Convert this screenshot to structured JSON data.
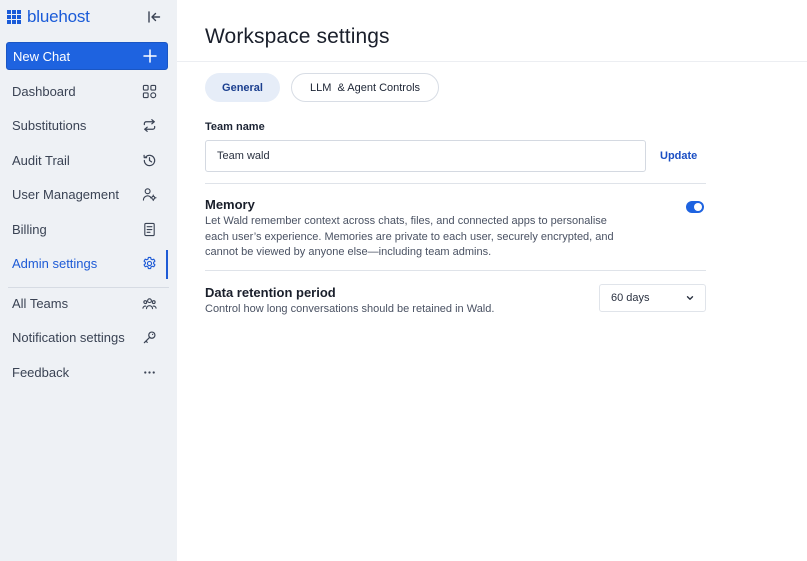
{
  "brand": {
    "name": "bluehost"
  },
  "sidebar": {
    "new_chat_label": "New Chat",
    "items": [
      {
        "label": "Dashboard",
        "icon": "dashboard-icon"
      },
      {
        "label": "Substitutions",
        "icon": "swap-icon"
      },
      {
        "label": "Audit Trail",
        "icon": "history-icon"
      },
      {
        "label": "User Management",
        "icon": "user-management-icon"
      },
      {
        "label": "Billing",
        "icon": "billing-icon"
      },
      {
        "label": "Admin settings",
        "icon": "gear-icon",
        "active": true
      }
    ],
    "secondary_items": [
      {
        "label": "All Teams",
        "icon": "teams-icon"
      },
      {
        "label": "Notification settings",
        "icon": "key-icon"
      },
      {
        "label": "Feedback",
        "icon": "more-icon"
      }
    ]
  },
  "main": {
    "title": "Workspace settings",
    "tabs": [
      {
        "label": "General",
        "active": true
      },
      {
        "label": "LLM  & Agent Controls",
        "active": false
      }
    ],
    "team": {
      "label": "Team name",
      "value": "Team wald",
      "update_label": "Update"
    },
    "memory": {
      "title": "Memory",
      "description": "Let Wald remember context across chats, files, and connected apps to personalise each user’s experience. Memories are private to each user, securely encrypted, and cannot be viewed by anyone else—including team admins.",
      "enabled": true
    },
    "retention": {
      "title": "Data retention period",
      "description": "Control how long conversations should be retained in Wald.",
      "selected": "60 days"
    }
  },
  "colors": {
    "accent": "#1e63e0",
    "sidebar_bg": "#eef1f5",
    "active_tab_bg": "#e6edf8"
  }
}
